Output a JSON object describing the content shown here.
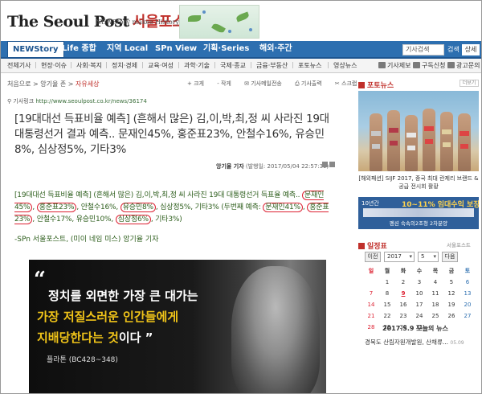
{
  "header": {
    "logo_en": "The Seoul Post",
    "logo_ko": "서울포스트",
    "tagline": "NEWStory makes History"
  },
  "nav": {
    "items": [
      "NEWStory",
      "Life 종합",
      "지역 Local",
      "SPn View",
      "기획·Series",
      "해외·주간"
    ],
    "search_placeholder": "기사검색",
    "search_label": "검색",
    "detail_label": "상세"
  },
  "subnav": {
    "items": [
      "전체기사",
      "현장·이슈",
      "사회·복지",
      "정치·경제",
      "교육·여성",
      "과학·기술",
      "국제·종교",
      "금융·부동산",
      "포토뉴스",
      "영상뉴스"
    ],
    "right": [
      "기사제보",
      "구독신청",
      "광고문의"
    ]
  },
  "article": {
    "crumb_home": "처음으로",
    "crumb_section": "앙기율 존",
    "crumb_cat": "자유세상",
    "tools": [
      "크게",
      "작게",
      "기사메일전송",
      "기사출력",
      "스크랩"
    ],
    "url_label": "기사링크",
    "url": "http://www.seoulpost.co.kr/news/36174",
    "title": "[19대대선 득표비율 예측] (흔해서 많은) 김,이,박,최,정 씨 사라진 19대 대통령선거 결과 예측.. 문재인45%, 홍준표23%, 안철수16%, 유승민8%, 심상정5%, 기타3%",
    "byline_author": "앙기율 기자",
    "byline_date": "(발행일: 2017/05/04 22:57:39)",
    "body_p1_a": "[19대대선 득표비율 예측] (흔해서 많은) 김,이,박,최,정 씨 사라진 19대 대통령선거 득표율 예측.. ",
    "first": {
      "moon": "문재인45%",
      "hong": "홍준표23%",
      "ahn": "안철수16%",
      "yoo": "유승민8%",
      "sim": "심상정5%",
      "etc": "기타3%"
    },
    "second_label": "(두번째 예측: ",
    "second": {
      "moon": "문재인41%",
      "hong": "홍준표23%",
      "ahn": "안철수17%",
      "yoo": "유승민10%",
      "sim": "심상정6%",
      "etc": "기타3%)"
    },
    "signature": "-SPn 서울포스트, (미이 네임 미스) 앙기율 기자",
    "quote": {
      "line1": "정치를 외면한 가장 큰 대가는",
      "line2": "가장 저질스러운 인간들에게",
      "line3_a": "지배당한다는 것",
      "line3_b": "이다",
      "author": "플라톤 (BC428~348)"
    }
  },
  "sidebar": {
    "photo_title": "포토뉴스",
    "more": "더보기",
    "photo_caption": "[해외패션] SIJF 2017, 중국 최대 란제리 브랜드 & 공급 전시회 활황",
    "ad": {
      "t1": "10년간",
      "t2": "10~11% 임대수익 보장",
      "t3": "펜션 숙속의2조청 2차분양"
    },
    "calendar_title": "일정표",
    "calendar_more": "서울포스트",
    "year": "2017",
    "month": "5",
    "prev": "이전",
    "next": "다음",
    "weekdays": [
      "일",
      "월",
      "화",
      "수",
      "목",
      "금",
      "토"
    ],
    "weeks": [
      [
        "",
        "1",
        "2",
        "3",
        "4",
        "5",
        "6"
      ],
      [
        "7",
        "8",
        "9",
        "10",
        "11",
        "12",
        "13"
      ],
      [
        "14",
        "15",
        "16",
        "17",
        "18",
        "19",
        "20"
      ],
      [
        "21",
        "22",
        "23",
        "24",
        "25",
        "26",
        "27"
      ],
      [
        "28",
        "29",
        "30",
        "31",
        "",
        "",
        ""
      ]
    ],
    "today_label": "2017.5.9 오늘의 뉴스",
    "news_item": "경북도 산림자원개발원, 산채류...",
    "news_date": "05.09"
  }
}
